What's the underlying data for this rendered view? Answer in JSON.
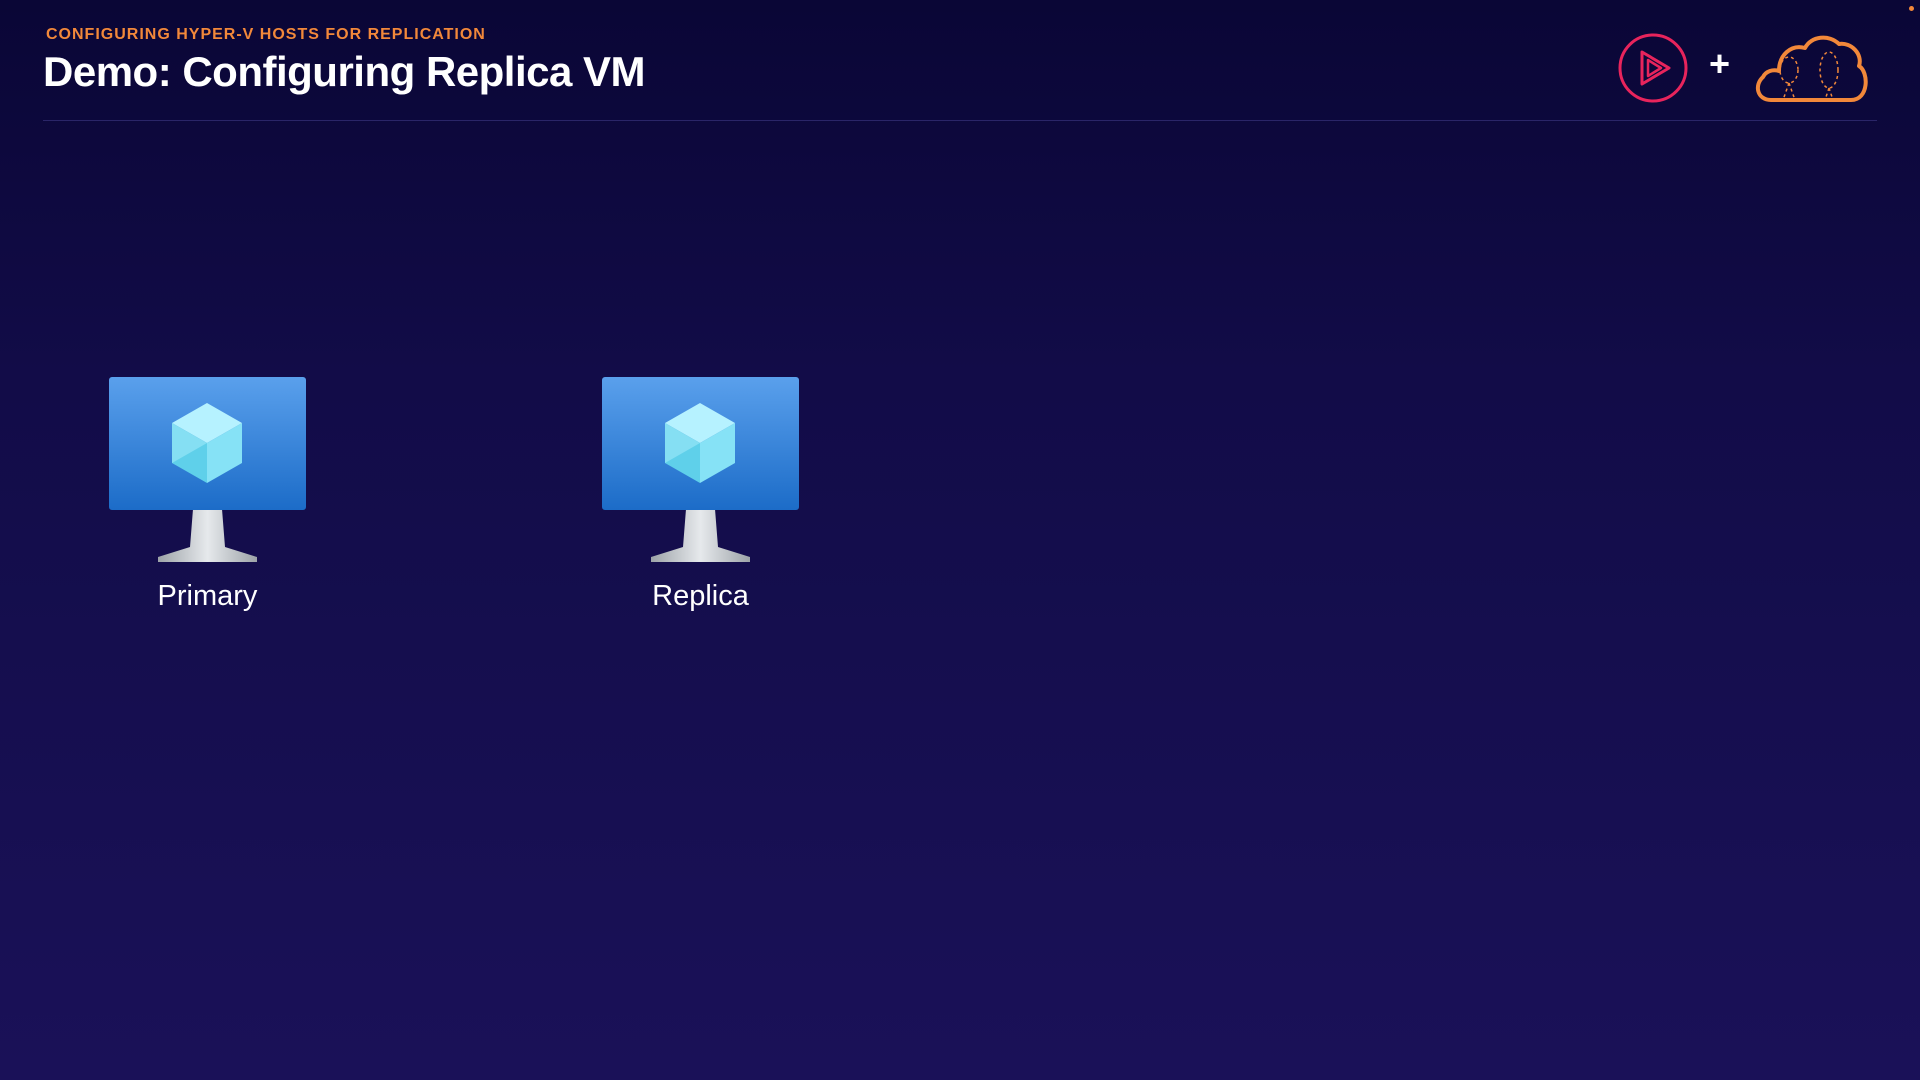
{
  "header": {
    "eyebrow": "CONFIGURING HYPER-V HOSTS FOR REPLICATION",
    "title": "Demo: Configuring Replica VM",
    "plus_sign": "+"
  },
  "icons": {
    "play_logo": "play-circle-icon",
    "cloud_logo": "cloud-icon",
    "vm": "virtual-machine-monitor-icon"
  },
  "colors": {
    "accent_orange": "#f2883a",
    "play_logo": "#e8245c",
    "background_top": "#0a0636",
    "background_bottom": "#1a1158",
    "monitor_blue": "#2f80d8"
  },
  "diagram": {
    "primary_label": "Primary",
    "replica_label": "Replica"
  }
}
